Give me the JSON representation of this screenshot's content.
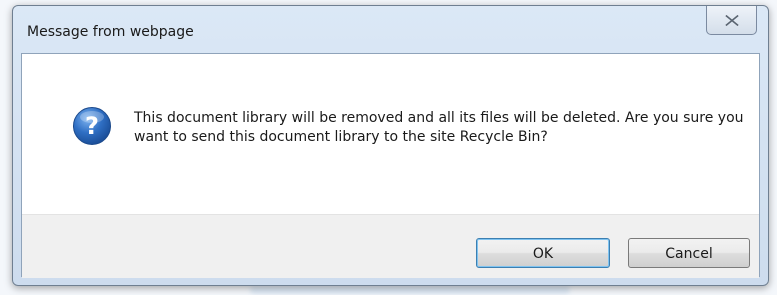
{
  "window": {
    "title": "Message from webpage"
  },
  "message": {
    "text": "This document library will be removed and all its files will be deleted. Are you sure you want to send this document library to the site Recycle Bin?"
  },
  "buttons": {
    "ok_label": "OK",
    "cancel_label": "Cancel"
  },
  "icons": {
    "dialog_icon": "question-icon",
    "close": "close-icon"
  },
  "colors": {
    "question_icon": "#2f6fc4",
    "frame": "#cddcee"
  }
}
